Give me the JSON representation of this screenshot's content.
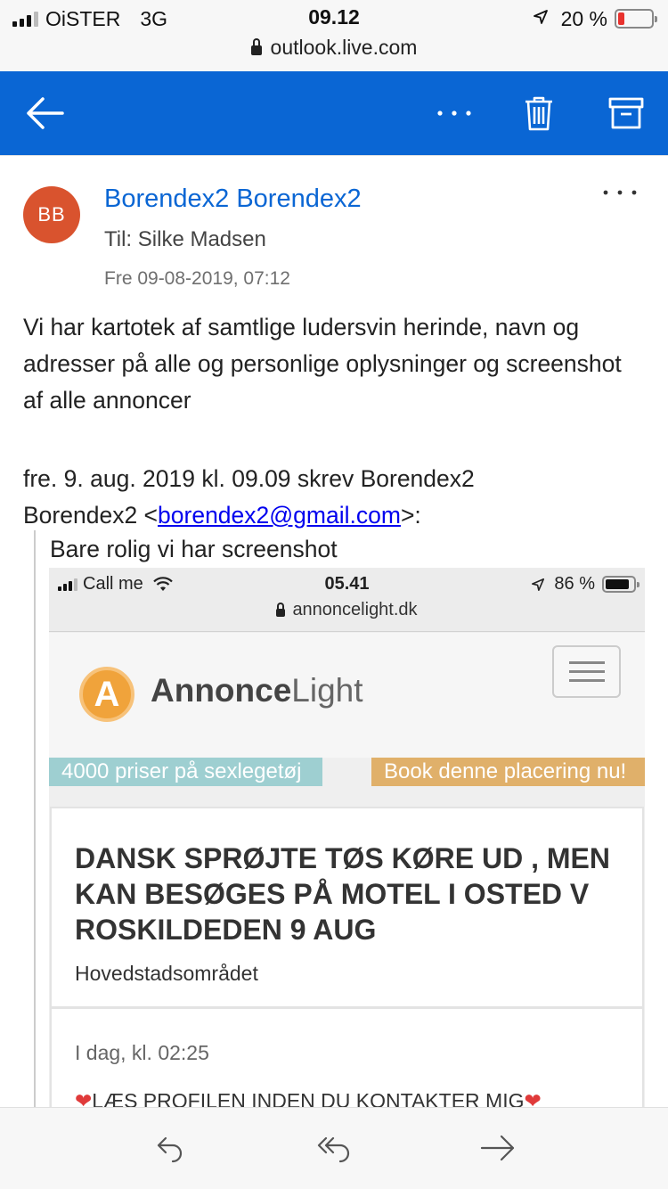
{
  "status_bar": {
    "carrier": "OiSTER",
    "network": "3G",
    "time": "09.12",
    "battery_percent": "20 %",
    "battery_level": 0.2,
    "battery_color": "#e8322e"
  },
  "browser": {
    "url": "outlook.live.com"
  },
  "toolbar": {
    "back_icon": "back-arrow-icon",
    "more_icon": "more-dots-icon",
    "delete_icon": "trash-icon",
    "archive_icon": "archive-icon",
    "accent": "#0a66d4"
  },
  "message": {
    "avatar_initials": "BB",
    "avatar_color": "#d9532e",
    "sender": "Borendex2 Borendex2",
    "to_label": "Til: Silke Madsen",
    "date": "Fre 09-08-2019, 07:12",
    "body": "Vi har kartotek af samtlige ludersvin herinde, navn og adresser på alle og personlige oplysninger og screenshot af alle annoncer",
    "quote_header_line1": "fre. 9. aug. 2019 kl. 09.09 skrev Borendex2",
    "quote_header_prefix": "Borendex2 <",
    "quote_email": "borendex2@gmail.com",
    "quote_header_suffix": ">:",
    "quote_text": "Bare rolig vi har screenshot"
  },
  "embedded_screenshot": {
    "status": {
      "carrier": "Call me",
      "time": "05.41",
      "battery_percent": "86 %",
      "battery_level": 0.86
    },
    "url": "annoncelight.dk",
    "logo_letter": "A",
    "logo_bold": "Annonce",
    "logo_light": "Light",
    "ad_left": "4000 priser på sexlegetøj",
    "ad_right": "Book denne placering nu!",
    "listing_title": "DANSK SPRØJTE TØS KØRE UD , MEN KAN BESØGES PÅ MOTEL I OSTED V ROSKILDEDEN 9 AUG",
    "listing_region": "Hovedstadsområdet",
    "post_time": "I dag, kl. 02:25",
    "post_text": "LÆS PROFILEN INDEN DU KONTAKTER MIG"
  },
  "bottom_bar": {
    "reply_icon": "reply-icon",
    "reply_all_icon": "reply-all-icon",
    "forward_icon": "forward-icon"
  }
}
